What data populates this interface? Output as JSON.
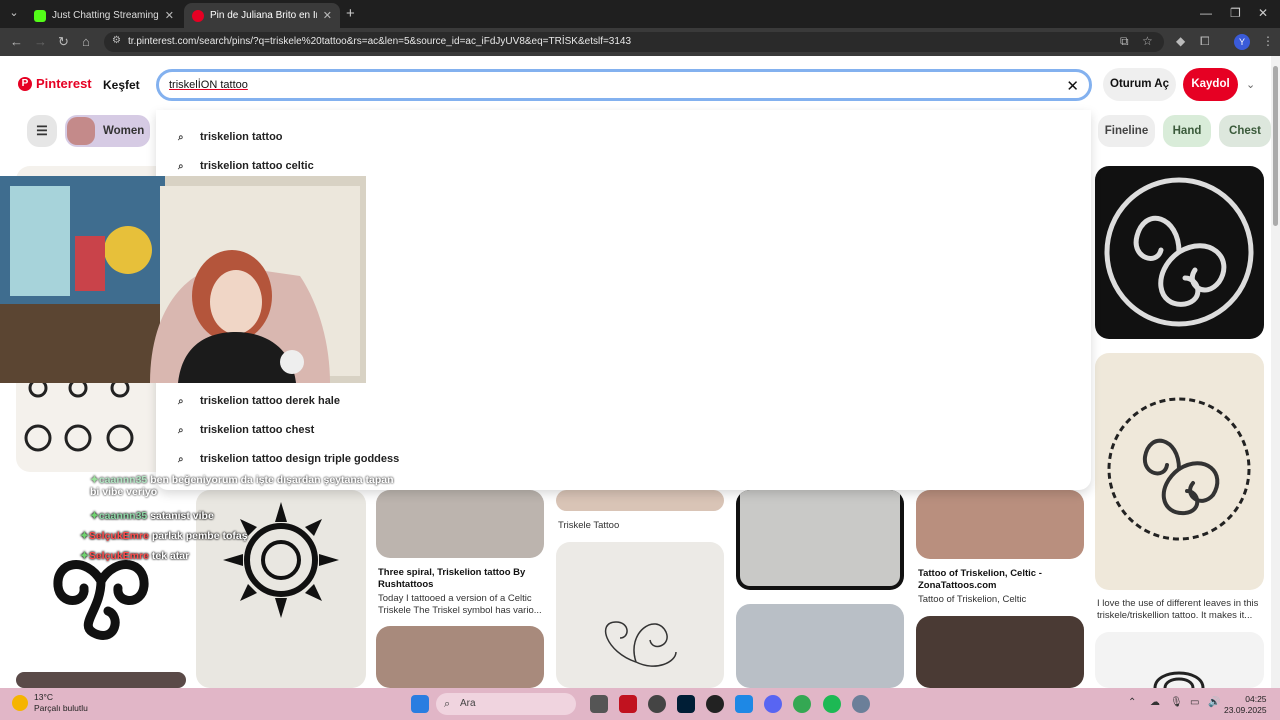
{
  "browser": {
    "tabs": [
      {
        "label": "Just Chatting Streaming - Live S",
        "active": false
      },
      {
        "label": "Pin de Juliana Brito en Inspiraçõ",
        "active": true
      }
    ],
    "url": "tr.pinterest.com/search/pins/?q=triskele%20tattoo&rs=ac&len=5&source_id=ac_iFdJyUV8&eq=TRİSK&etslf=3143",
    "profile_initial": "Y"
  },
  "header": {
    "logo": "Pinterest",
    "explore": "Keşfet",
    "search_value": "triskelİON tattoo",
    "login": "Oturum Aç",
    "signup": "Kaydol"
  },
  "chips": {
    "women": "Women",
    "fineline": "Fineline",
    "hand": "Hand",
    "chest": "Chest"
  },
  "suggestions": [
    "triskelion tattoo",
    "triskelion tattoo celtic",
    "triskelion tattoo derek hale",
    "triskelion tattoo chest",
    "triskelion tattoo design triple goddess"
  ],
  "pins": {
    "triskele_title": "Triskele Tattoo",
    "three_spiral_title": "Three spiral, Triskelion tattoo By Rushtattoos",
    "three_spiral_desc": "Today I tattooed a version of a Celtic Triskele The Triskel symbol has vario...",
    "zona_title": "Tattoo of Triskelion, Celtic - ZonaTattoos.com",
    "zona_desc": "Tattoo of Triskelion, Celtic",
    "leaves_desc": "I love the use of different leaves in this triskele/triskellion tattoo. It makes it..."
  },
  "chat": [
    {
      "user": "caannn35",
      "text": "ben beğeniyorum da işte dışardan şeytana tapan bi vibe veriyo"
    },
    {
      "user": "caannn35",
      "text": "satanist vibe"
    },
    {
      "user": "SelçukEmre",
      "text": "parlak pembe tofaş"
    },
    {
      "user": "SelçukEmre",
      "text": "tek atar"
    }
  ],
  "taskbar": {
    "temp": "13°C",
    "weather": "Parçalı bulutlu",
    "search": "Ara",
    "time": "04:25",
    "date": "23.09.2025"
  },
  "colors": {
    "brand": "#e60023",
    "search_focus": "#83b1ef",
    "taskbar": "#e1b6c7"
  }
}
